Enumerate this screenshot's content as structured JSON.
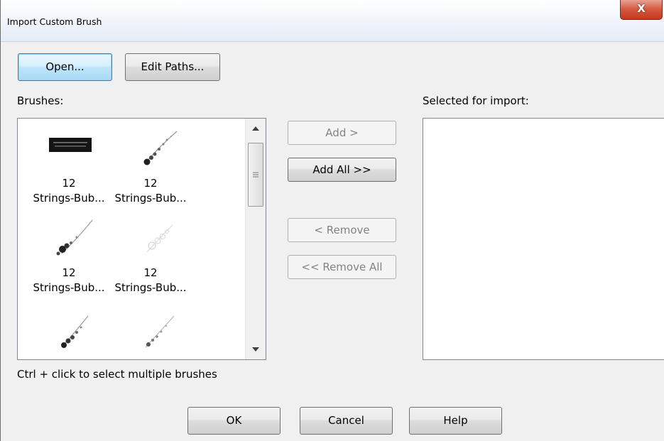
{
  "window": {
    "title": "Import Custom Brush",
    "close_glyph": "X"
  },
  "toolbar": {
    "open_label": "Open...",
    "edit_paths_label": "Edit Paths..."
  },
  "brushes": {
    "label": "Brushes:",
    "items": [
      {
        "line1": "12",
        "line2": "Strings-Bub...",
        "icon": "brush-thumbnail-text-banner"
      },
      {
        "line1": "12",
        "line2": "Strings-Bub...",
        "icon": "brush-thumbnail-bubble-string"
      },
      {
        "line1": "12",
        "line2": "Strings-Bub...",
        "icon": "brush-thumbnail-bubble-string"
      },
      {
        "line1": "12",
        "line2": "Strings-Bub...",
        "icon": "brush-thumbnail-faint-bubbles"
      },
      {
        "line1": "",
        "line2": "",
        "icon": "brush-thumbnail-bubble-string"
      },
      {
        "line1": "",
        "line2": "",
        "icon": "brush-thumbnail-bubble-string"
      }
    ],
    "hint": "Ctrl + click to select multiple brushes"
  },
  "actions": {
    "add_label": "Add >",
    "add_all_label": "Add All >>",
    "remove_label": "< Remove",
    "remove_all_label": "<< Remove All"
  },
  "selected": {
    "label": "Selected for import:"
  },
  "footer": {
    "ok_label": "OK",
    "cancel_label": "Cancel",
    "help_label": "Help"
  },
  "colors": {
    "close_button": "#c9462c",
    "focus_border": "#3c7fb1"
  }
}
